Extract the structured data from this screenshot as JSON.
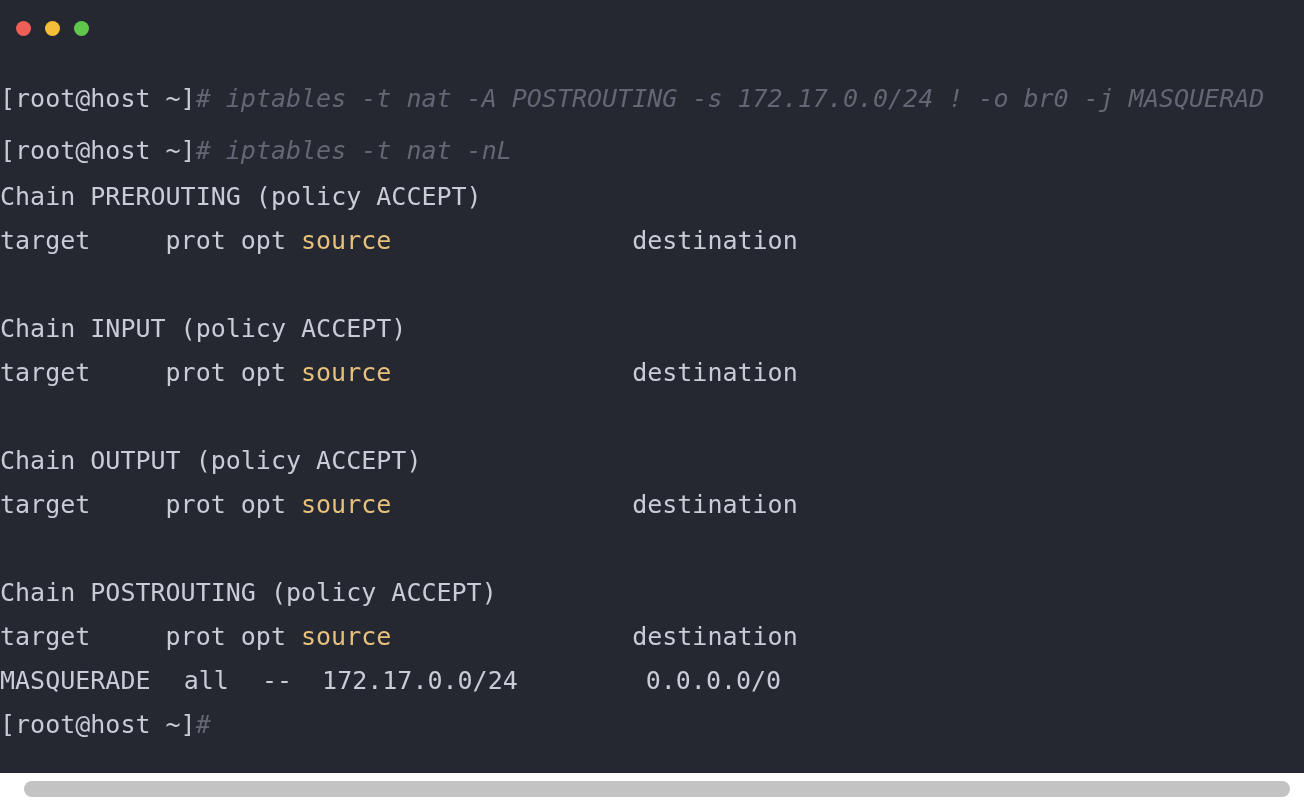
{
  "window": {
    "controls": [
      {
        "kind": "close"
      },
      {
        "kind": "minimize"
      },
      {
        "kind": "zoom"
      }
    ]
  },
  "lines": [
    {
      "kind": "prompt",
      "prompt": "[root@host ~]",
      "command": "# iptables -t nat -A POSTROUTING -s 172.17.0.0/24 ! -o br0 -j MASQUERAD"
    },
    {
      "kind": "prompt",
      "prompt": "[root@host ~]",
      "command": "# iptables -t nat -nL"
    },
    {
      "kind": "text",
      "text": "Chain PREROUTING (policy ACCEPT)"
    },
    {
      "kind": "columns",
      "cells": [
        {
          "text": "target",
          "highlight": false
        },
        {
          "text": "prot",
          "highlight": false
        },
        {
          "text": "opt",
          "highlight": false
        },
        {
          "text": "source",
          "highlight": true
        },
        {
          "text": "destination",
          "highlight": false
        }
      ]
    },
    {
      "kind": "blank"
    },
    {
      "kind": "text",
      "text": "Chain INPUT (policy ACCEPT)"
    },
    {
      "kind": "columns",
      "cells": [
        {
          "text": "target",
          "highlight": false
        },
        {
          "text": "prot",
          "highlight": false
        },
        {
          "text": "opt",
          "highlight": false
        },
        {
          "text": "source",
          "highlight": true
        },
        {
          "text": "destination",
          "highlight": false
        }
      ]
    },
    {
      "kind": "blank"
    },
    {
      "kind": "text",
      "text": "Chain OUTPUT (policy ACCEPT)"
    },
    {
      "kind": "columns",
      "cells": [
        {
          "text": "target",
          "highlight": false
        },
        {
          "text": "prot",
          "highlight": false
        },
        {
          "text": "opt",
          "highlight": false
        },
        {
          "text": "source",
          "highlight": true
        },
        {
          "text": "destination",
          "highlight": false
        }
      ]
    },
    {
      "kind": "blank"
    },
    {
      "kind": "text",
      "text": "Chain POSTROUTING (policy ACCEPT)"
    },
    {
      "kind": "columns",
      "cells": [
        {
          "text": "target",
          "highlight": false
        },
        {
          "text": "prot",
          "highlight": false
        },
        {
          "text": "opt",
          "highlight": false
        },
        {
          "text": "source",
          "highlight": true
        },
        {
          "text": "destination",
          "highlight": false
        }
      ]
    },
    {
      "kind": "row",
      "cells": [
        {
          "text": "MASQUERADE",
          "highlight": false
        },
        {
          "text": "all",
          "highlight": false
        },
        {
          "text": "--",
          "highlight": false
        },
        {
          "text": "172.17.0.0/24",
          "highlight": false
        },
        {
          "text": "0.0.0.0/0",
          "highlight": false
        }
      ]
    },
    {
      "kind": "prompt",
      "prompt": "[root@host ~]",
      "command": "#"
    }
  ]
}
